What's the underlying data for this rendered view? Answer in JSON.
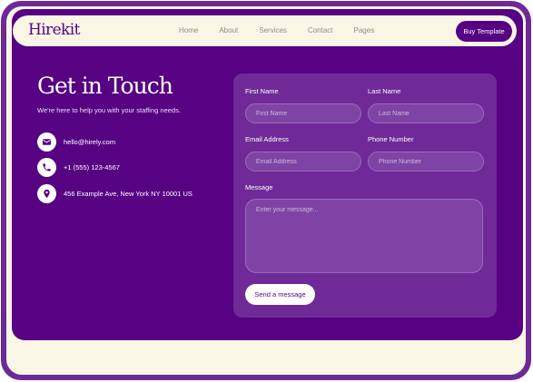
{
  "nav": {
    "logo": "Hirekit",
    "links": [
      "Home",
      "About",
      "Services",
      "Contact",
      "Pages"
    ],
    "cta": "Buy Template"
  },
  "hero": {
    "title": "Get in Touch",
    "subtitle": "We're here to help you with your staffing needs."
  },
  "contact": {
    "email": "hello@hirely.com",
    "phone": "+1 (555) 123-4567",
    "address": "456 Example Ave, New York NY 10001 US",
    "icons": [
      "mail-icon",
      "phone-icon",
      "location-pin-icon"
    ]
  },
  "form": {
    "first_name": {
      "label": "First Name",
      "placeholder": "First Name",
      "value": ""
    },
    "last_name": {
      "label": "Last Name",
      "placeholder": "Last Name",
      "value": ""
    },
    "email": {
      "label": "Email Address",
      "placeholder": "Email Address",
      "value": ""
    },
    "phone": {
      "label": "Phone Number",
      "placeholder": "Phone Number",
      "value": ""
    },
    "message": {
      "label": "Message",
      "placeholder": "Enter your message...",
      "value": ""
    },
    "submit": "Send a message"
  },
  "colors": {
    "brand_purple": "#560282",
    "frame_purple": "#6b2a96",
    "cream": "#faf6e6",
    "card_purple": "#6f2a98"
  }
}
